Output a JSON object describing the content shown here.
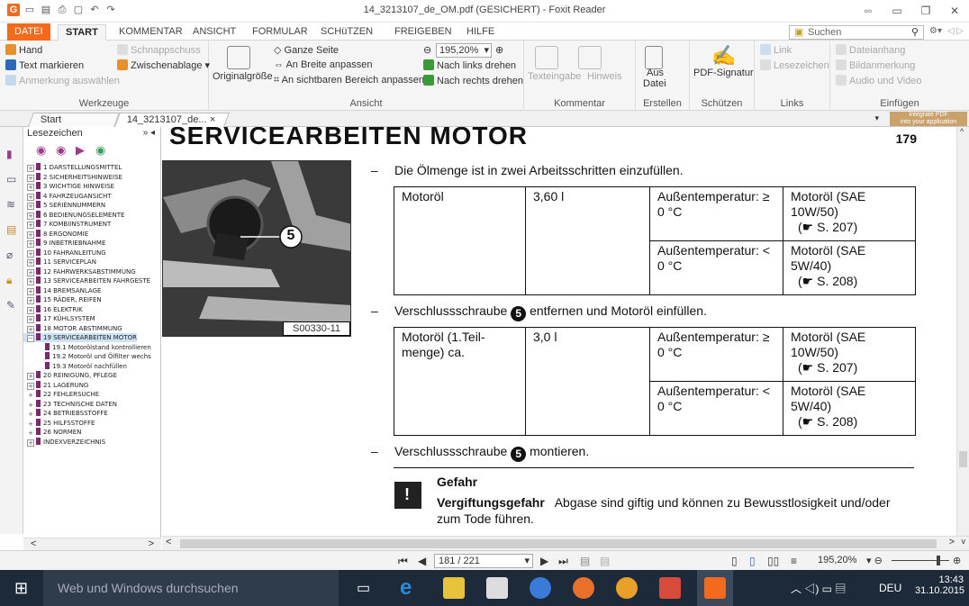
{
  "window": {
    "title": "14_3213107_de_OM.pdf (GESICHERT) - Foxit Reader"
  },
  "ribbon_tabs": [
    "DATEI",
    "START",
    "KOMMENTAR",
    "ANSICHT",
    "FORMULAR",
    "SCHüTZEN",
    "FREIGEBEN",
    "HILFE"
  ],
  "search": {
    "placeholder": "Suchen"
  },
  "ribbon": {
    "werkzeuge": {
      "label": "Werkzeuge",
      "hand": "Hand",
      "text_markieren": "Text markieren",
      "anmerkung": "Anmerkung auswählen",
      "schnappschuss": "Schnappschuss",
      "zwischenablage": "Zwischenablage"
    },
    "ansicht": {
      "label": "Ansicht",
      "originalgroesse": "Originalgröße",
      "ganze_seite": "Ganze Seite",
      "an_breite": "An Breite anpassen",
      "an_bereich": "An sichtbaren Bereich anpassen",
      "zoom": "195,20%",
      "links_drehen": "Nach links drehen",
      "rechts_drehen": "Nach rechts drehen"
    },
    "kommentar": {
      "label": "Kommentar",
      "texteingabe": "Texteingabe",
      "hinweis": "Hinweis"
    },
    "erstellen": {
      "label": "Erstellen",
      "aus_datei_1": "Aus",
      "aus_datei_2": "Datei"
    },
    "schuetzen": {
      "label": "Schützen",
      "pdf_signatur": "PDF-Signatur"
    },
    "links": {
      "label": "Links",
      "link": "Link",
      "lesezeichen": "Lesezeichen"
    },
    "einfuegen": {
      "label": "Einfügen",
      "dateianhang": "Dateianhang",
      "bildanmerkung": "Bildanmerkung",
      "audio": "Audio und Video"
    }
  },
  "doc_tabs": {
    "start": "Start",
    "file": "14_3213107_de...",
    "ad_line1": "Integrate PDF",
    "ad_line2": "into your application"
  },
  "bookmarks": {
    "title": "Lesezeichen",
    "items": [
      "1 DARSTELLUNGSMITTEL",
      "2 SICHERHEITSHINWEISE",
      "3 WICHTIGE HINWEISE",
      "4 FAHRZEUGANSICHT",
      "5 SERIENNUMMERN",
      "6 BEDIENUNGSELEMENTE",
      "7 KOMBIINSTRUMENT",
      "8 ERGONOMIE",
      "9 INBETRIEBNAHME",
      "10 FAHRANLEITUNG",
      "11 SERVICEPLAN",
      "12 FAHRWERKSABSTIMMUNG",
      "13 SERVICEARBEITEN FAHRGESTE",
      "14 BREMSANLAGE",
      "15 RÄDER, REIFEN",
      "16 ELEKTRIK",
      "17 KÜHLSYSTEM",
      "18 MOTOR ABSTIMMUNG",
      "19 SERVICEARBEITEN MOTOR"
    ],
    "subitems": [
      "19.1 Motorölstand kontrollieren",
      "19.2 Motoröl und Ölfilter wechs",
      "19.3 Motoröl nachfüllen"
    ],
    "items_after": [
      "20 REINIGUNG, PFLEGE",
      "21 LAGERUNG",
      "22 FEHLERSUCHE",
      "23 TECHNISCHE DATEN",
      "24 BETRIEBSSTOFFE",
      "25 HILFSSTOFFE",
      "26 NORMEN",
      "INDEXVERZEICHNIS"
    ]
  },
  "page": {
    "heading": "SERVICEARBEITEN MOTOR",
    "number": "179",
    "photo_caption": "S00330-11",
    "photo_marker": "5",
    "step1": "Die Ölmenge ist in zwei Arbeitsschritten einzufüllen.",
    "table1": {
      "c1": "Motoröl",
      "c2": "3,60 l",
      "r1_temp": "Außentemperatur: ≥ 0 °C",
      "r1_oil": "Motoröl (SAE 10W/50)",
      "r1_ref": "(☛ S. 207)",
      "r2_temp": "Außentemperatur: < 0 °C",
      "r2_oil": "Motoröl (SAE 5W/40)",
      "r2_ref": "(☛ S. 208)"
    },
    "step2_a": "Verschlussschraube",
    "step2_b": "entfernen und Motoröl einfüllen.",
    "table2": {
      "c1": "Motoröl (1.Teil-menge) ca.",
      "c2": "3,0 l",
      "r1_temp": "Außentemperatur: ≥ 0 °C",
      "r1_oil": "Motoröl (SAE 10W/50)",
      "r1_ref": "(☛ S. 207)",
      "r2_temp": "Außentemperatur: < 0 °C",
      "r2_oil": "Motoröl (SAE 5W/40)",
      "r2_ref": "(☛ S. 208)"
    },
    "step3_a": "Verschlussschraube",
    "step3_b": "montieren.",
    "warning_title": "Gefahr",
    "warning_bold": "Vergiftungsgefahr",
    "warning_text": "Abgase sind giftig und können zu Bewusstlosigkeit und/oder zum Tode führen."
  },
  "status": {
    "page_indicator": "181 / 221",
    "zoom": "195,20%"
  },
  "taskbar": {
    "search": "Web und Windows durchsuchen",
    "lang": "DEU",
    "time": "13:43",
    "date": "31.10.2015"
  }
}
